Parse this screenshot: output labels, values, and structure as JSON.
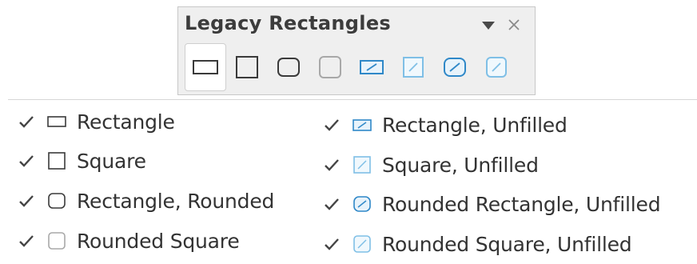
{
  "toolbar": {
    "title": "Legacy Rectangles",
    "buttons": [
      {
        "icon": "rectangle-icon",
        "active": true
      },
      {
        "icon": "square-icon"
      },
      {
        "icon": "rectangle-rounded-icon"
      },
      {
        "icon": "rounded-square-icon"
      },
      {
        "icon": "rectangle-unfilled-icon"
      },
      {
        "icon": "square-unfilled-icon"
      },
      {
        "icon": "rounded-rectangle-unfilled-icon"
      },
      {
        "icon": "rounded-square-unfilled-icon"
      }
    ]
  },
  "menu": {
    "left": [
      {
        "label": "Rectangle",
        "checked": true,
        "icon": "rectangle-icon"
      },
      {
        "label": "Square",
        "checked": true,
        "icon": "square-icon"
      },
      {
        "label": "Rectangle, Rounded",
        "checked": true,
        "icon": "rectangle-rounded-icon"
      },
      {
        "label": "Rounded Square",
        "checked": true,
        "icon": "rounded-square-icon"
      }
    ],
    "right": [
      {
        "label": "Rectangle, Unfilled",
        "checked": true,
        "icon": "rectangle-unfilled-icon"
      },
      {
        "label": "Square, Unfilled",
        "checked": true,
        "icon": "square-unfilled-icon"
      },
      {
        "label": "Rounded Rectangle, Unfilled",
        "checked": true,
        "icon": "rounded-rectangle-unfilled-icon"
      },
      {
        "label": "Rounded Square, Unfilled",
        "checked": true,
        "icon": "rounded-square-unfilled-icon"
      }
    ]
  },
  "colors": {
    "outline": "#3a3a3a",
    "light_outline": "#a8a8a8",
    "accent": "#2f88c8",
    "light_accent": "#7fbfe6"
  }
}
